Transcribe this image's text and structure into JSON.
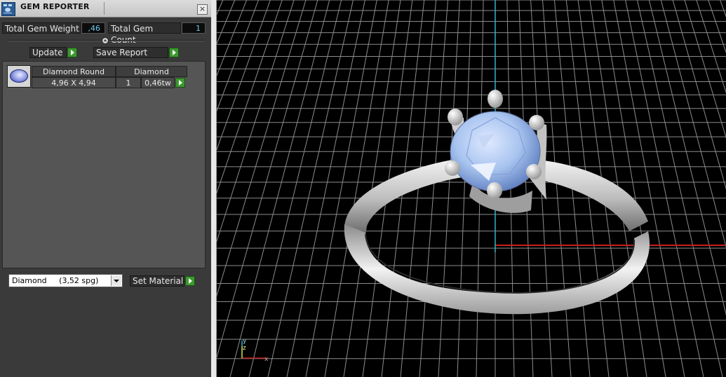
{
  "window": {
    "title": "GEM REPORTER",
    "close_symbol": "×"
  },
  "summary": {
    "weight_label": "Total Gem Weight",
    "weight_value": ",46",
    "count_label": "Total Gem Count",
    "count_value": "1"
  },
  "actions": {
    "update_label": "Update",
    "save_label": "Save Report"
  },
  "gem_table": {
    "headers": [
      "Diamond Round",
      "Diamond"
    ],
    "rows": [
      {
        "size": "4,96 X 4,94",
        "count": "1",
        "weight": "0,46tw"
      }
    ]
  },
  "material": {
    "selected": "Diamond     (3,52 spg)",
    "set_label": "Set Material"
  },
  "viewport": {
    "axis_labels": {
      "y": "y",
      "z": "z",
      "x": "x"
    },
    "colors": {
      "grid": "#8c8c8c",
      "y_axis": "#2fb6c8",
      "x_axis": "#c81e1e",
      "gem": "#a8c4ef",
      "metal": "#d2d2d2"
    }
  }
}
